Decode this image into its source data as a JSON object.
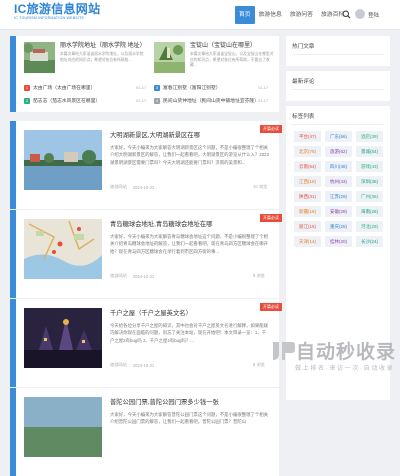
{
  "header": {
    "logo_main": "IC旅游信息网站",
    "logo_sub": "IC TOURISM INFORMATION WEBSITE",
    "nav": [
      "首页",
      "旅游信息",
      "旅游问答",
      "旅游百科"
    ],
    "login": "登陆"
  },
  "top_posts": [
    {
      "title": "丽水学院地址（丽水学院 地址）",
      "desc": "本篇文章给大家谈谈丽水学院地址，以及丽水学院地址对应的知识点，希望对各位有所帮助..."
    },
    {
      "title": "宝锭山（宝锭山在哪里）",
      "desc": "本篇文章给大家谈谈宝锭山，以及宝锭山在哪里对应的知识点，希望对各位有所帮助，不要忘了收藏..."
    }
  ],
  "top_list": [
    {
      "badge": "1",
      "title": "太由广场（太由广场在哪里）",
      "date": "01-17"
    },
    {
      "badge": "2",
      "title": "茄志志（茄志水风景区在哪里）",
      "date": "01-17"
    },
    {
      "badge": "3",
      "title": "富春江别墅（富阳江别墅）",
      "date": "01-17"
    },
    {
      "badge": "4",
      "title": "民间山货仲地址（民间山货中铺地址宜芬隆）",
      "date": "01-17"
    }
  ],
  "posts": [
    {
      "title": "大明湖新景区,大明湖新景区在哪",
      "desc": "大家好，今天小编来为大家解答大明湖新景区这个问题，不是小编很整理了个相关介绍大明湖新景区的解答，让我们一起看看吧。大明湖景区的游览从什么入？2022湖景明湖景区需要门票吗？今天大明湖还能要门票吗？济南的美景和...",
      "meta_author": "旅游网站",
      "meta_date": "2024-10-31",
      "comments": "10 浏览",
      "ribbon": "开篇必读"
    },
    {
      "title": "青岛糖球会地址,青岛糖球会地址在哪",
      "desc": "大家好，今天小编来为大家解答青岛糖球会地址这个问题，不是小编很整理了个相关介绍青岛糖球会地址的解答，让我们一起看看吧。现在青岛四方区糖球会在哪开始？现在青岛四方区糖球会在举行着到市区四方街的事...",
      "meta_author": "旅游网站",
      "meta_date": "2024-10-31",
      "comments": "9 浏览",
      "ribbon": "开篇必读"
    },
    {
      "title": "千户之屋（千户之屋英文名）",
      "desc": "今天给各位分享千户之屋的知识，其中也会对千户之屋英文名进行解释，如果能碰巧解决你现在面临的问题，别忘了关注本站，现在开始吧！本文目录一览：1、千户之屋2有bug吗 2、千户之屋2有bug吗？...",
      "meta_author": "旅游网站",
      "meta_date": "2024-10-31",
      "comments": "8 浏览",
      "ribbon": "开篇必读"
    },
    {
      "title": "普陀公园门票,普陀公园门票多少钱一张",
      "desc": "大家好，今天小编来为大家解答普陀公园门票这个问题，不是小编很整理了个相关介绍普陀公园门票的解答，让我们一起看看吧。普陀公园门票？普陀山"
    }
  ],
  "widgets": {
    "hot": "热门文章",
    "recent": "最新评论",
    "tags_title": "标签列表"
  },
  "tags": [
    [
      "平台(47)",
      "广东(66)",
      "酒店(39)"
    ],
    [
      "北京(75)",
      "旅游(62)",
      "景城(54)"
    ],
    [
      "云南(54)",
      "四川(48)",
      "游戏(43)"
    ],
    [
      "江西(18)",
      "杭州(43)",
      "深圳(36)"
    ],
    [
      "陕西(31)",
      "江苏(29)",
      "广州(36)"
    ],
    [
      "新疆(16)",
      "安徽(28)",
      "海南(26)"
    ],
    [
      "丽江(15)",
      "重庆(25)",
      "河北(29)"
    ],
    [
      "天津(14)",
      "桂林(20)",
      "长沙(24)"
    ]
  ],
  "colors": {
    "accent": "#3a8bd8",
    "ribbon": "#e74c3c"
  },
  "watermark": {
    "main": "自动秒收录",
    "sub": "做 上 排 名 · 来 访 一 次 · 自 动 收 录"
  }
}
